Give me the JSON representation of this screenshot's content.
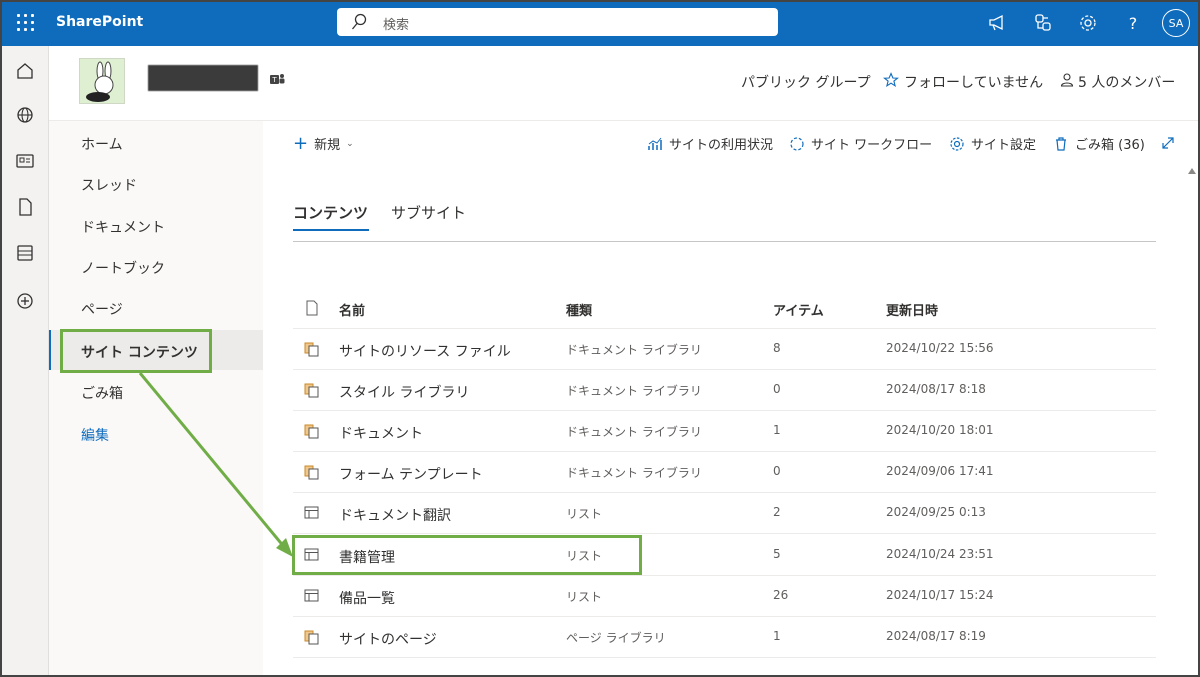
{
  "suite": {
    "brand": "SharePoint",
    "search_placeholder": "検索",
    "avatar_initials": "SA"
  },
  "site_header": {
    "privacy": "パブリック グループ",
    "follow": "フォローしていません",
    "members": "5 人のメンバー"
  },
  "left_nav": {
    "items": [
      {
        "label": "ホーム"
      },
      {
        "label": "スレッド"
      },
      {
        "label": "ドキュメント"
      },
      {
        "label": "ノートブック"
      },
      {
        "label": "ページ"
      },
      {
        "label": "サイト コンテンツ"
      },
      {
        "label": "ごみ箱"
      },
      {
        "label": "編集"
      }
    ],
    "selected_index": 5
  },
  "command_bar": {
    "new_label": "新規",
    "site_usage": "サイトの利用状況",
    "site_workflows": "サイト ワークフロー",
    "site_settings": "サイト設定",
    "recycle_bin": "ごみ箱 (36)"
  },
  "tabs": [
    {
      "label": "コンテンツ",
      "active": true
    },
    {
      "label": "サブサイト",
      "active": false
    }
  ],
  "table": {
    "headers": {
      "name": "名前",
      "type": "種類",
      "items": "アイテム",
      "modified": "更新日時"
    },
    "rows": [
      {
        "icon": "library-icon",
        "name": "サイトのリソース ファイル",
        "type": "ドキュメント ライブラリ",
        "items": "8",
        "modified": "2024/10/22 15:56"
      },
      {
        "icon": "library-icon",
        "name": "スタイル ライブラリ",
        "type": "ドキュメント ライブラリ",
        "items": "0",
        "modified": "2024/08/17 8:18"
      },
      {
        "icon": "library-icon",
        "name": "ドキュメント",
        "type": "ドキュメント ライブラリ",
        "items": "1",
        "modified": "2024/10/20 18:01"
      },
      {
        "icon": "library-icon",
        "name": "フォーム テンプレート",
        "type": "ドキュメント ライブラリ",
        "items": "0",
        "modified": "2024/09/06 17:41"
      },
      {
        "icon": "list-icon",
        "name": "ドキュメント翻訳",
        "type": "リスト",
        "items": "2",
        "modified": "2024/09/25 0:13"
      },
      {
        "icon": "list-icon",
        "name": "書籍管理",
        "type": "リスト",
        "items": "5",
        "modified": "2024/10/24 23:51"
      },
      {
        "icon": "list-icon",
        "name": "備品一覧",
        "type": "リスト",
        "items": "26",
        "modified": "2024/10/17 15:24"
      },
      {
        "icon": "library-icon",
        "name": "サイトのページ",
        "type": "ページ ライブラリ",
        "items": "1",
        "modified": "2024/08/17 8:19"
      }
    ]
  },
  "colors": {
    "suite_bar": "#0f6cbd",
    "highlight": "#70ad47"
  }
}
